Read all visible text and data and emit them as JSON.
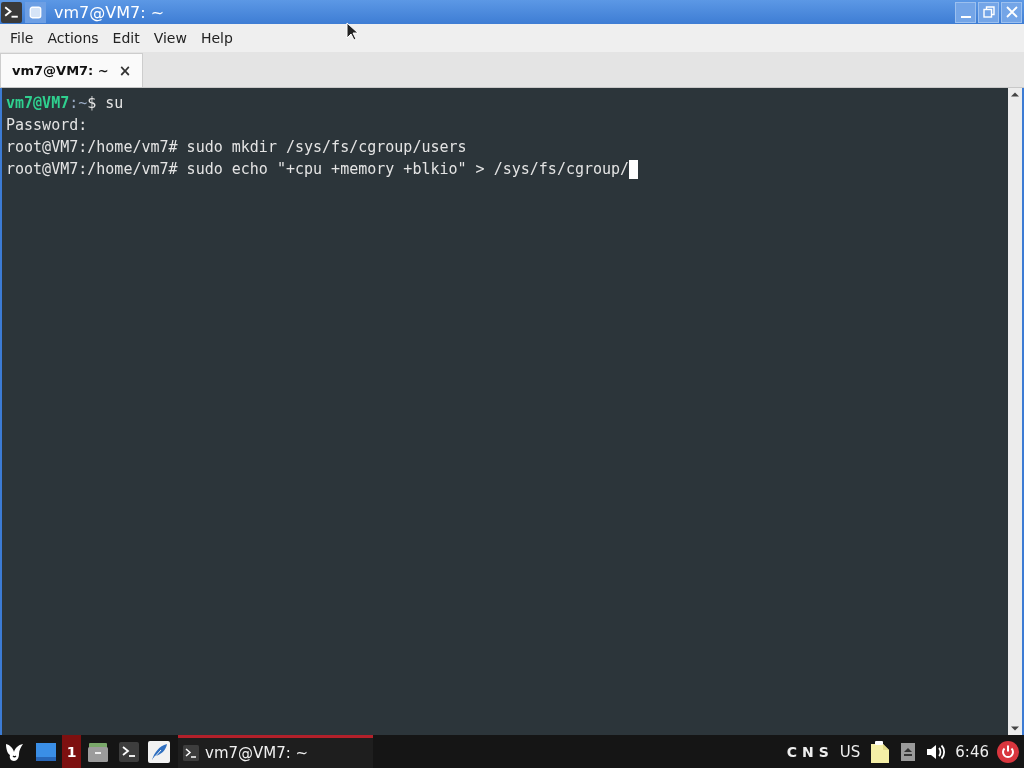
{
  "window": {
    "title": "vm7@VM7: ~"
  },
  "menu": [
    {
      "label": "File"
    },
    {
      "label": "Actions"
    },
    {
      "label": "Edit"
    },
    {
      "label": "View"
    },
    {
      "label": "Help"
    }
  ],
  "tabs": [
    {
      "label": "vm7@VM7: ~",
      "close": "×",
      "selected": true
    }
  ],
  "terminal": {
    "lines": [
      {
        "segments": [
          {
            "kind": "user",
            "text": "vm7@VM7"
          },
          {
            "kind": "path",
            "text": ":~"
          },
          {
            "kind": "plain",
            "text": "$ su"
          }
        ]
      },
      {
        "segments": [
          {
            "kind": "plain",
            "text": "Password:"
          }
        ]
      },
      {
        "segments": [
          {
            "kind": "plain",
            "text": "root@VM7:/home/vm7# sudo mkdir /sys/fs/cgroup/users"
          }
        ]
      },
      {
        "segments": [
          {
            "kind": "plain",
            "text": "root@VM7:/home/vm7# sudo echo \"+cpu +memory +blkio\" > /sys/fs/cgroup/"
          }
        ]
      }
    ],
    "cursor": true
  },
  "taskbar": {
    "workspaces": [
      {
        "label": "1",
        "selected": true
      }
    ],
    "tasks": [
      {
        "label": "vm7@VM7: ~",
        "selected": true
      }
    ],
    "locks": [
      "C",
      "N",
      "S"
    ],
    "keyboard_layout": "US",
    "clock": "6:46"
  }
}
